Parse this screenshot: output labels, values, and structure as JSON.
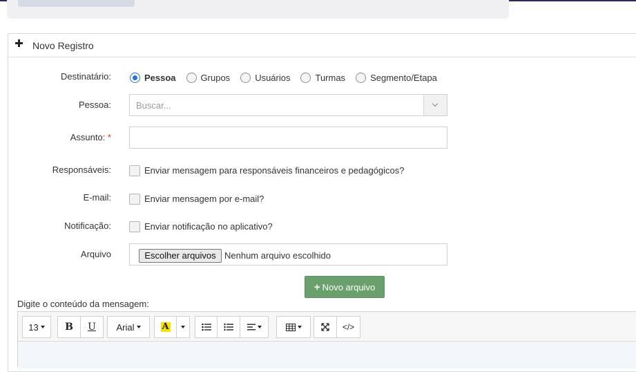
{
  "panel": {
    "title": "Novo Registro"
  },
  "form": {
    "destinatario": {
      "label": "Destinatário:",
      "options": [
        "Pessoa",
        "Grupos",
        "Usuários",
        "Turmas",
        "Segmento/Etapa"
      ],
      "selected": "Pessoa"
    },
    "pessoa": {
      "label": "Pessoa:",
      "placeholder": "Buscar..."
    },
    "assunto": {
      "label": "Assunto:",
      "required_mark": "*",
      "value": ""
    },
    "responsaveis": {
      "label": "Responsáveis:",
      "text": "Enviar mensagem para responsáveis financeiros e pedagógicos?"
    },
    "email": {
      "label": "E-mail:",
      "text": "Enviar mensagem por e-mail?"
    },
    "notificacao": {
      "label": "Notificação:",
      "text": "Enviar notificação no aplicativo?"
    },
    "arquivo": {
      "label": "Arquivo",
      "button": "Escolher arquivos",
      "status": "Nenhum arquivo escolhido"
    },
    "novo_arquivo": {
      "label": "Novo arquivo"
    },
    "mensagem": {
      "label": "Digite o conteúdo da mensagem:"
    }
  },
  "toolbar": {
    "font_size": "13",
    "bold": "B",
    "underline": "U",
    "font_family": "Arial",
    "highlight": "A",
    "code": "</>"
  },
  "colors": {
    "accent": "#1a73e8",
    "green_button": "#6aa06c",
    "required": "#c0392b"
  }
}
